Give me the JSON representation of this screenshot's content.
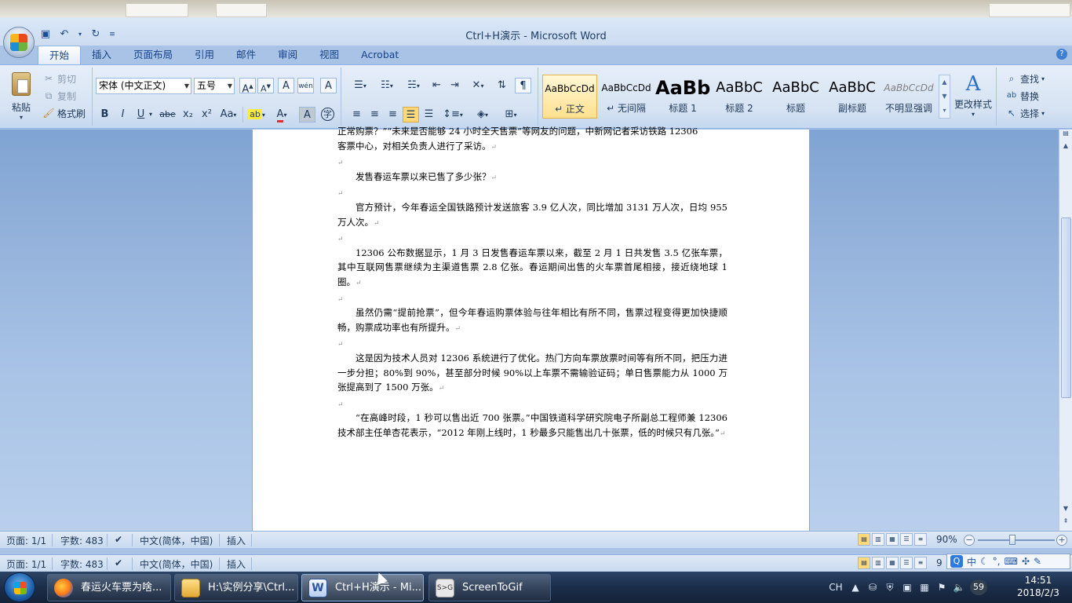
{
  "window": {
    "title": "Ctrl+H演示 - Microsoft Word"
  },
  "quick_access": {
    "save_icon": "save-icon",
    "undo_icon": "undo-icon",
    "redo_icon": "redo-icon",
    "customize_icon": "customize-icon"
  },
  "tabs": [
    "开始",
    "插入",
    "页面布局",
    "引用",
    "邮件",
    "审阅",
    "视图",
    "Acrobat"
  ],
  "ribbon": {
    "clipboard": {
      "paste": "粘贴",
      "cut": "剪切",
      "copy": "复制",
      "format_painter": "格式刷"
    },
    "font": {
      "font_name": "宋体 (中文正文)",
      "font_size": "五号",
      "bold": "B",
      "italic": "I",
      "underline": "U",
      "strike": "abe",
      "subscript": "x₂",
      "superscript": "x²",
      "change_case": "Aa",
      "grow": "A",
      "shrink": "A",
      "clear": "A",
      "phonetic": "wén",
      "border": "A",
      "font_color": "A",
      "shading": "A"
    },
    "styles": [
      {
        "preview": "AaBbCcDd",
        "label": "↵ 正文"
      },
      {
        "preview": "AaBbCcDd",
        "label": "↵ 无间隔"
      },
      {
        "preview": "AaBb",
        "label": "标题 1"
      },
      {
        "preview": "AaBbC",
        "label": "标题 2"
      },
      {
        "preview": "AaBbC",
        "label": "标题"
      },
      {
        "preview": "AaBbC",
        "label": "副标题"
      },
      {
        "preview": "AaBbCcDd",
        "label": "不明显强调"
      }
    ],
    "change_styles": "更改样式",
    "editing": {
      "find": "查找",
      "replace": "替换",
      "select": "选择"
    }
  },
  "document": {
    "top_partial_line": "正常购票？”“未来是否能够 24 小时全天售票”等网友的问题，中新网记者采访铁路 12306",
    "top_partial_line_2": "客票中心，对相关负责人进行了采访。",
    "para1": "发售春运车票以来已售了多少张？",
    "para2": "官方预计，今年春运全国铁路预计发送旅客 3.9 亿人次，同比增加 3131 万人次，日均 955 万人次。",
    "para3": "12306 公布数据显示，1 月 3 日发售春运车票以来，截至 2 月 1 日共发售 3.5 亿张车票，其中互联网售票继续为主渠道售票 2.8 亿张。春运期间出售的火车票首尾相接，接近绕地球 1 圈。",
    "para4": "虽然仍需“提前抢票”，但今年春运购票体验与往年相比有所不同，售票过程变得更加快捷顺畅，购票成功率也有所提升。",
    "para5": "这是因为技术人员对 12306 系统进行了优化。热门方向车票放票时间等有所不同，把压力进一步分担；80%到 90%，甚至部分时候 90%以上车票不需输验证码；单日售票能力从 1000 万张提高到了 1500 万张。",
    "para6": "“在高峰时段，1 秒可以售出近 700 张票。”中国铁道科学研究院电子所副总工程师兼 12306 技术部主任单杏花表示，“2012 年刚上线时，1 秒最多只能售出几十张票，低的时候只有几张。”",
    "para_mark": "↵"
  },
  "status": {
    "page": "页面: 1/1",
    "words": "字数: 483",
    "language": "中文(简体，中国)",
    "mode": "插入",
    "zoom": "90%",
    "zoom_fraction": 0.45,
    "zoom_partial": "9"
  },
  "taskbar": {
    "items": [
      {
        "label": "春运火车票为啥...",
        "icon": "firefox-icon"
      },
      {
        "label": "H:\\实例分享\\Ctrl...",
        "icon": "folder-icon"
      },
      {
        "label": "Ctrl+H演示 - Mi...",
        "icon": "word-icon"
      },
      {
        "label": "ScreenToGif",
        "icon": "screentogif-icon"
      }
    ],
    "tray_lang": "CH",
    "tray_badge": "59",
    "time": "14:51",
    "date": "2018/2/3"
  },
  "ime": {
    "mode": "中"
  }
}
